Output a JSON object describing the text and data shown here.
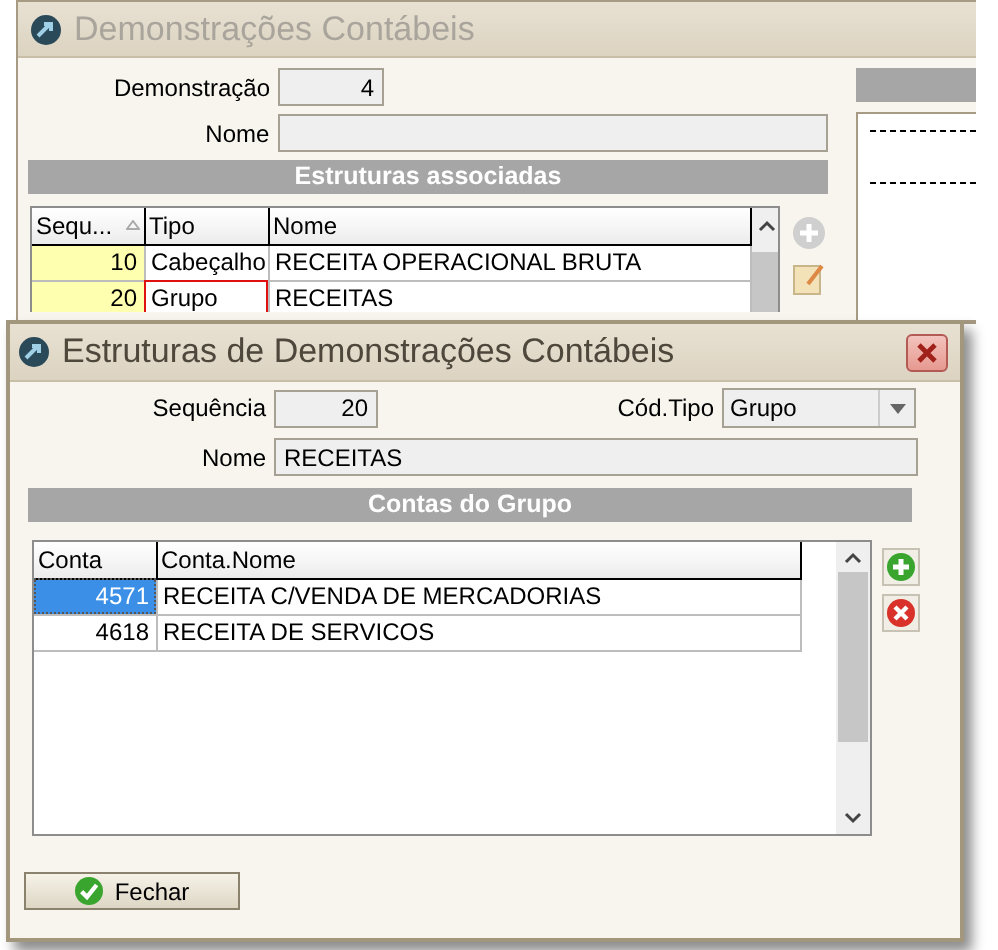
{
  "back_window": {
    "title": "Demonstrações Contábeis",
    "fields": [
      {
        "label": "Demonstração",
        "value": "4"
      },
      {
        "label": "Nome"
      }
    ],
    "section_title": "Estruturas associadas",
    "table": {
      "columns": [
        "Sequ...",
        "Tipo",
        "Nome"
      ],
      "rows": [
        {
          "cells": [
            "10",
            "Cabeçalho",
            "RECEITA OPERACIONAL BRUTA"
          ],
          "selected": false
        },
        {
          "cells": [
            "20",
            "Grupo",
            "RECEITAS"
          ],
          "selected": true
        }
      ]
    }
  },
  "front_window": {
    "title": "Estruturas de Demonstrações Contábeis",
    "sequencia": {
      "label": "Sequência",
      "value": "20"
    },
    "cod_tipo": {
      "label": "Cód.Tipo",
      "value": "Grupo"
    },
    "nome": {
      "label": "Nome",
      "value": "RECEITAS"
    },
    "section_title": "Contas do Grupo",
    "table": {
      "columns": [
        "Conta",
        "Conta.Nome"
      ],
      "rows": [
        {
          "cells": [
            "4571",
            "RECEITA C/VENDA DE MERCADORIAS"
          ],
          "selected": true
        },
        {
          "cells": [
            "4618",
            "RECEITA DE SERVICOS"
          ],
          "selected": false
        }
      ]
    },
    "button": "Fechar"
  }
}
